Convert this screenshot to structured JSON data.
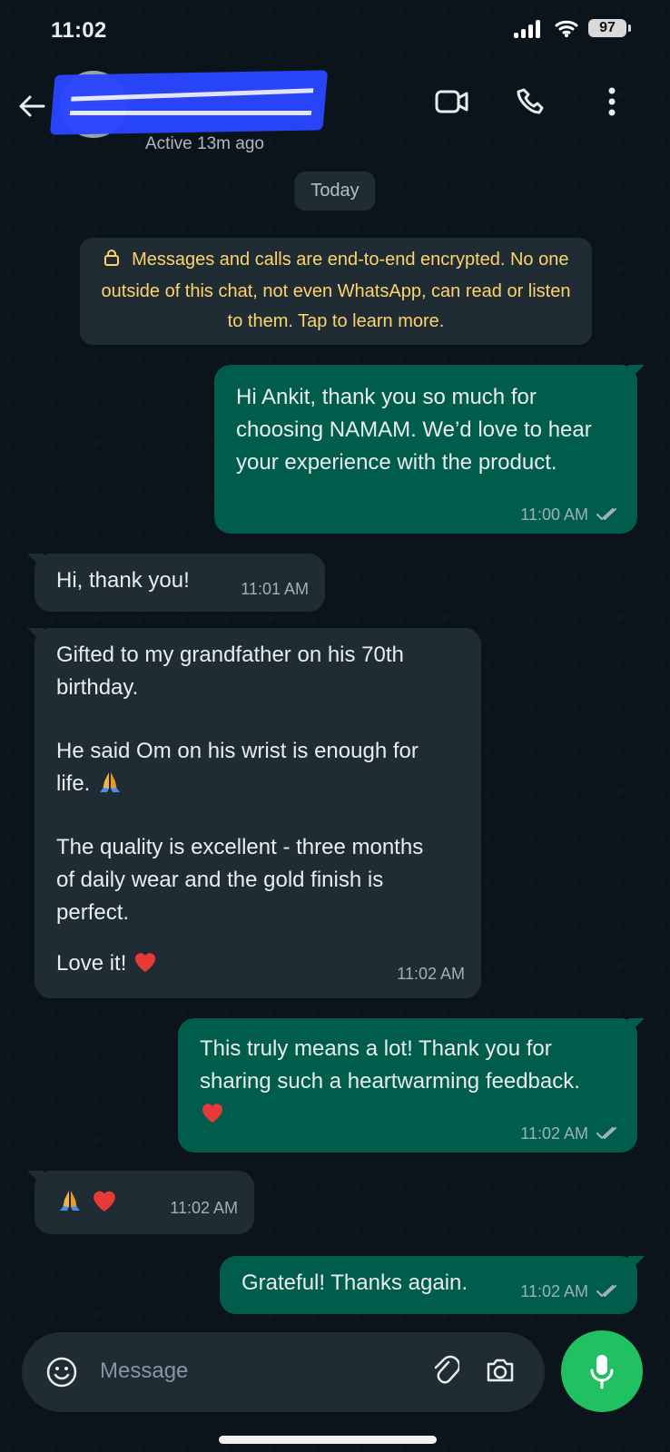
{
  "status_bar": {
    "time": "11:02",
    "battery": "97"
  },
  "header": {
    "contact_status": "Active 13m ago"
  },
  "chat": {
    "date_label": "Today",
    "encryption_notice": "Messages and calls are end-to-end encrypted. No one outside of this chat, not even WhatsApp, can read or listen to them. Tap to learn more.",
    "messages": [
      {
        "direction": "outgoing",
        "text": "Hi Ankit, thank you so much for choosing NAMAM. We’d love to hear your experience with the product.",
        "time": "11:00 AM"
      },
      {
        "direction": "incoming",
        "text": "Hi, thank you!",
        "time": "11:01 AM"
      },
      {
        "direction": "incoming",
        "text_parts": [
          "Gifted to my grandfather on his 70th birthday.",
          "He said Om on his wrist is enough for life.",
          "The quality is excellent - three months of daily wear and the gold finish is perfect.",
          "Love it!"
        ],
        "time": "11:02 AM"
      },
      {
        "direction": "outgoing",
        "text": "This truly means a lot! Thank you for sharing such a heartwarming feedback.",
        "time": "11:02 AM"
      },
      {
        "direction": "incoming",
        "time": "11:02 AM"
      },
      {
        "direction": "outgoing",
        "text": "Grateful! Thanks again.",
        "time": "11:02 AM"
      }
    ]
  },
  "composer": {
    "placeholder": "Message"
  },
  "icons": {
    "back": "arrow-left-icon",
    "video": "video-call-icon",
    "call": "phone-icon",
    "menu": "more-vertical-icon",
    "lock": "lock-icon",
    "emoji": "emoji-icon",
    "attach": "paperclip-icon",
    "camera": "camera-icon",
    "mic": "microphone-icon",
    "read_receipt": "double-check-icon",
    "heart": "red-heart-icon",
    "pray": "folded-hands-icon"
  },
  "colors": {
    "background": "#0b141a",
    "outgoing_bubble": "#005c4b",
    "incoming_bubble": "#202c33",
    "accent": "#21c063",
    "notice_text": "#ffd36a"
  }
}
